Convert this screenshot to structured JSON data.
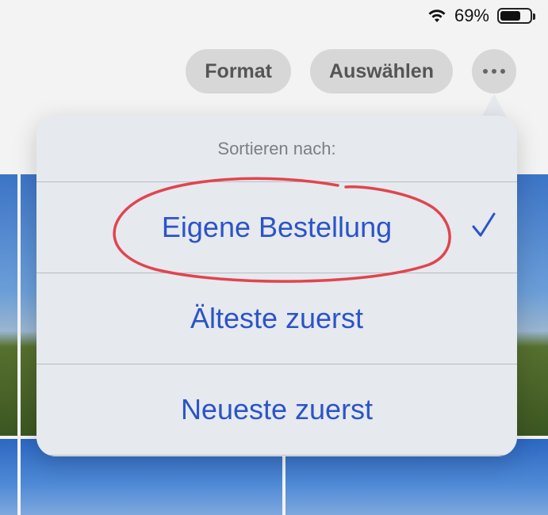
{
  "status_bar": {
    "battery_percent_text": "69%",
    "battery_level": 0.69,
    "icons": [
      "wifi-icon",
      "battery-icon"
    ]
  },
  "toolbar": {
    "format_label": "Format",
    "select_label": "Auswählen",
    "more_icon": "ellipsis-icon"
  },
  "menu": {
    "header": "Sortieren nach:",
    "items": [
      {
        "label": "Eigene Bestellung",
        "selected": true
      },
      {
        "label": "Älteste zuerst",
        "selected": false
      },
      {
        "label": "Neueste zuerst",
        "selected": false
      }
    ],
    "check_icon": "checkmark-icon"
  },
  "colors": {
    "accent": "#2b54c8",
    "annotation": "#e0454f",
    "menu_bg": "#e6e9ee"
  }
}
